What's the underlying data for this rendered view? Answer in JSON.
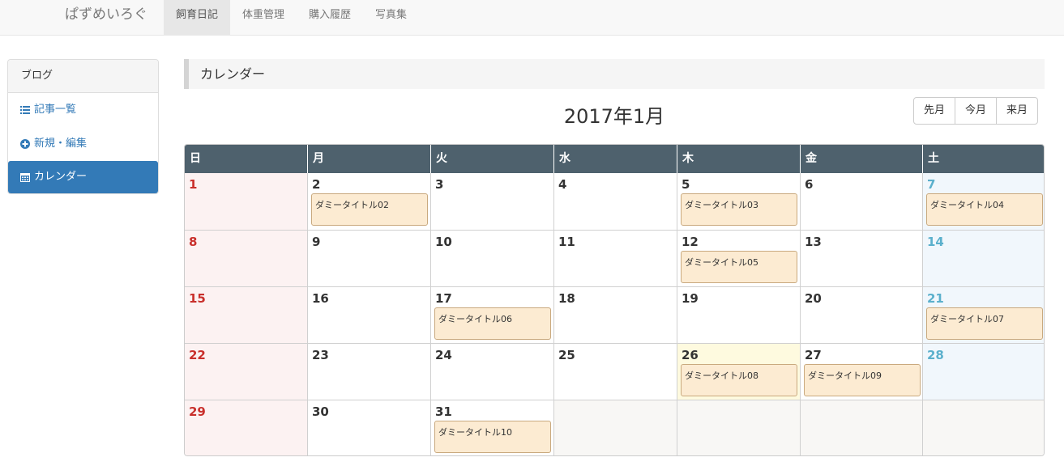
{
  "navbar": {
    "brand": "ぱずめいろぐ",
    "items": [
      {
        "label": "飼育日記",
        "active": true
      },
      {
        "label": "体重管理",
        "active": false
      },
      {
        "label": "購入履歴",
        "active": false
      },
      {
        "label": "写真集",
        "active": false
      }
    ]
  },
  "sidebar": {
    "title": "ブログ",
    "items": [
      {
        "label": "記事一覧",
        "icon": "list-icon"
      },
      {
        "label": "新規・編集",
        "icon": "plus-circle-icon"
      },
      {
        "label": "カレンダー",
        "icon": "calendar-icon",
        "active": true
      }
    ]
  },
  "main": {
    "section_title": "カレンダー",
    "month_title": "2017年1月",
    "buttons": {
      "prev": "先月",
      "today": "今月",
      "next": "来月"
    }
  },
  "calendar": {
    "weekdays": [
      "日",
      "月",
      "火",
      "水",
      "木",
      "金",
      "土"
    ],
    "weeks": [
      [
        {
          "day": "1",
          "events": []
        },
        {
          "day": "2",
          "events": [
            "ダミータイトル02"
          ]
        },
        {
          "day": "3",
          "events": []
        },
        {
          "day": "4",
          "events": []
        },
        {
          "day": "5",
          "events": [
            "ダミータイトル03"
          ]
        },
        {
          "day": "6",
          "events": []
        },
        {
          "day": "7",
          "events": [
            "ダミータイトル04"
          ]
        }
      ],
      [
        {
          "day": "8",
          "events": []
        },
        {
          "day": "9",
          "events": []
        },
        {
          "day": "10",
          "events": []
        },
        {
          "day": "11",
          "events": []
        },
        {
          "day": "12",
          "events": [
            "ダミータイトル05"
          ]
        },
        {
          "day": "13",
          "events": []
        },
        {
          "day": "14",
          "events": []
        }
      ],
      [
        {
          "day": "15",
          "events": []
        },
        {
          "day": "16",
          "events": []
        },
        {
          "day": "17",
          "events": [
            "ダミータイトル06"
          ]
        },
        {
          "day": "18",
          "events": []
        },
        {
          "day": "19",
          "events": []
        },
        {
          "day": "20",
          "events": []
        },
        {
          "day": "21",
          "events": [
            "ダミータイトル07"
          ]
        }
      ],
      [
        {
          "day": "22",
          "events": []
        },
        {
          "day": "23",
          "events": []
        },
        {
          "day": "24",
          "events": []
        },
        {
          "day": "25",
          "events": []
        },
        {
          "day": "26",
          "events": [
            "ダミータイトル08"
          ],
          "today": true
        },
        {
          "day": "27",
          "events": [
            "ダミータイトル09"
          ]
        },
        {
          "day": "28",
          "events": []
        }
      ],
      [
        {
          "day": "29",
          "events": []
        },
        {
          "day": "30",
          "events": []
        },
        {
          "day": "31",
          "events": [
            "ダミータイトル10"
          ]
        },
        {
          "day": "",
          "events": []
        },
        {
          "day": "",
          "events": []
        },
        {
          "day": "",
          "events": []
        },
        {
          "day": "",
          "events": []
        }
      ]
    ]
  },
  "colors": {
    "header_bg": "#4e616d",
    "sunday_bg": "#fcf2f2",
    "saturday_bg": "#f1f7fc",
    "today_bg": "#fefadf",
    "event_bg": "#fcebd2",
    "sunday_text": "#c9302c",
    "saturday_text": "#5bb0cc",
    "active_blue": "#337ab7"
  }
}
